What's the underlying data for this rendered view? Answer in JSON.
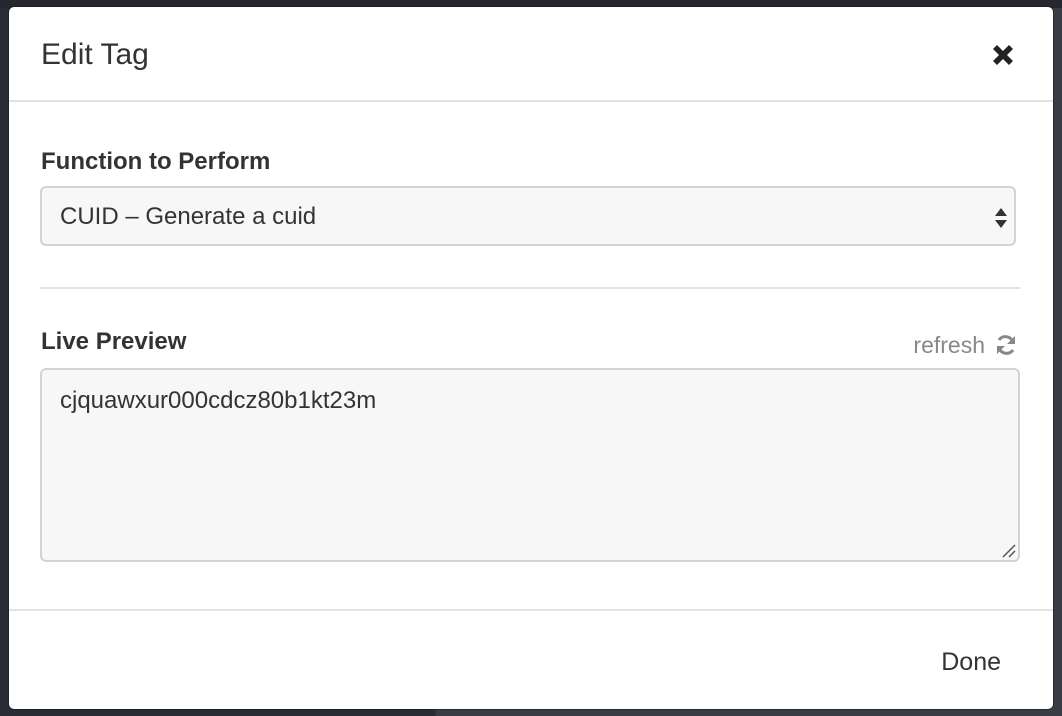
{
  "modal": {
    "title": "Edit Tag",
    "close_icon": "close-icon"
  },
  "function_field": {
    "label": "Function to Perform",
    "selected": "CUID – Generate a cuid",
    "arrows_icon": "select-arrows-icon"
  },
  "preview": {
    "label": "Live Preview",
    "refresh_label": "refresh",
    "refresh_icon": "refresh-icon",
    "value": "cjquawxur000cdcz80b1kt23m"
  },
  "footer": {
    "done_label": "Done"
  },
  "colors": {
    "text": "#333333",
    "muted": "#888888",
    "border": "#d3d3d3",
    "field_bg": "#f7f7f7",
    "divider": "#e3e3e3"
  }
}
